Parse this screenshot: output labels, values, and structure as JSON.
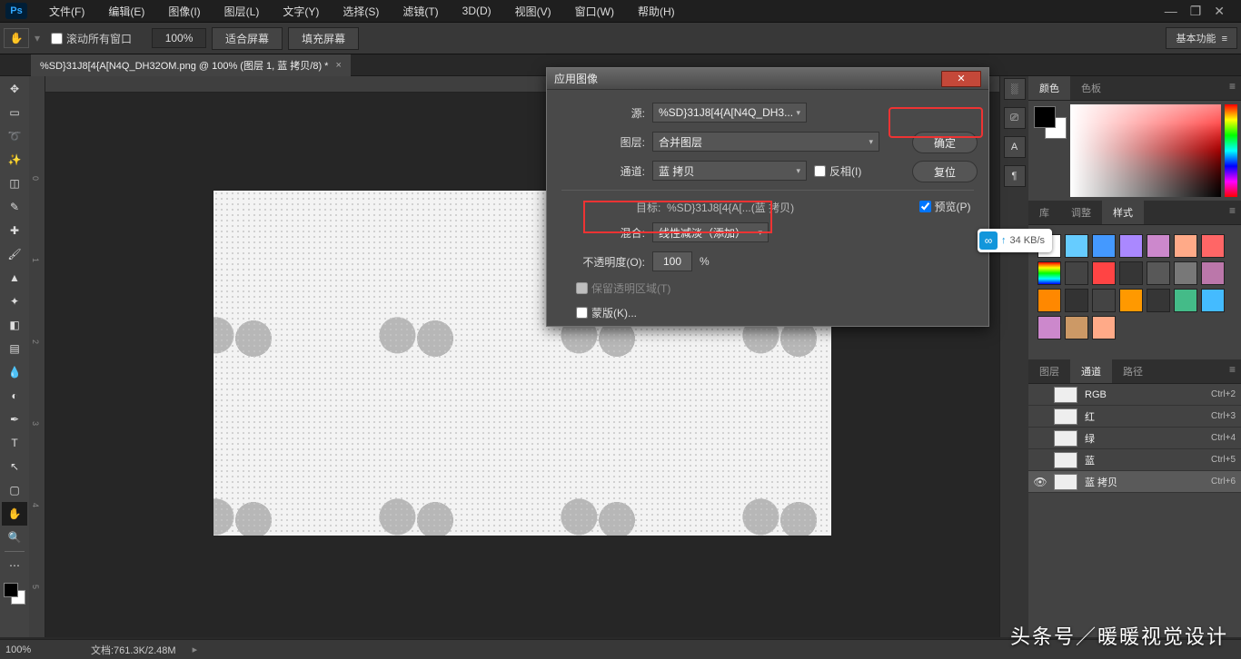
{
  "app": {
    "logo": "Ps"
  },
  "menus": [
    "文件(F)",
    "编辑(E)",
    "图像(I)",
    "图层(L)",
    "文字(Y)",
    "选择(S)",
    "滤镜(T)",
    "3D(D)",
    "视图(V)",
    "窗口(W)",
    "帮助(H)"
  ],
  "window_controls": [
    "—",
    "❐",
    "✕"
  ],
  "options": {
    "scroll_all": "滚动所有窗口",
    "zoom_pct": "100%",
    "fit_screen": "适合屏幕",
    "fill_screen": "填充屏幕",
    "workspace": "基本功能"
  },
  "doc_tab": {
    "title": "%SD}31J8[4{A[N4Q_DH32OM.png @ 100% (图层 1, 蓝 拷贝/8) *"
  },
  "tools": [
    "↔",
    "▭",
    "✂",
    "✎",
    "⟂",
    "◌",
    "✐",
    "▲",
    "✦",
    "◧",
    "◆",
    "✎",
    "✢",
    "T",
    "↖",
    "⟲",
    "✋",
    "⤢"
  ],
  "rulers_v": [
    "0",
    "1",
    "2",
    "3",
    "4",
    "5"
  ],
  "dialog": {
    "title": "应用图像",
    "source_label": "源:",
    "source_value": "%SD}31J8[4{A[N4Q_DH3...",
    "layer_label": "图层:",
    "layer_value": "合并图层",
    "channel_label": "通道:",
    "channel_value": "蓝 拷贝",
    "invert": "反相(I)",
    "target_label": "目标:",
    "target_value": "%SD}31J8[4{A[...(蓝 拷贝)",
    "blend_label": "混合:",
    "blend_value": "线性减淡（添加）",
    "opacity_label": "不透明度(O):",
    "opacity_value": "100",
    "opacity_pct": "%",
    "preserve": "保留透明区域(T)",
    "mask": "蒙版(K)...",
    "ok": "确定",
    "reset": "复位",
    "preview": "预览(P)"
  },
  "color_tabs": [
    "颜色",
    "色板"
  ],
  "style_tabs": [
    "库",
    "调整",
    "样式"
  ],
  "layer_tabs": [
    "图层",
    "通道",
    "路径"
  ],
  "channels": [
    {
      "name": "RGB",
      "key": "Ctrl+2",
      "eye": false,
      "sel": false
    },
    {
      "name": "红",
      "key": "Ctrl+3",
      "eye": false,
      "sel": false
    },
    {
      "name": "绿",
      "key": "Ctrl+4",
      "eye": false,
      "sel": false
    },
    {
      "name": "蓝",
      "key": "Ctrl+5",
      "eye": false,
      "sel": false
    },
    {
      "name": "蓝 拷贝",
      "key": "Ctrl+6",
      "eye": true,
      "sel": true
    }
  ],
  "swatch_colors": [
    "#fff",
    "#6cf",
    "#49f",
    "#a8f",
    "#c8c",
    "#fa8",
    "#f66",
    "linear-gradient(#f00,#ff0,#0f0,#0ff,#00f)",
    "#444",
    "#f44",
    "#363636",
    "#585858",
    "#787878",
    "#b7a",
    "#f80",
    "#333",
    "#444",
    "#f90",
    "#363636",
    "#4b8",
    "#4bf",
    "#c8c",
    "#c96",
    "#fa8"
  ],
  "upload": {
    "speed": "34 KB/s"
  },
  "status": {
    "zoom": "100%",
    "doc": "文档:761.3K/2.48M"
  },
  "right_icons": [
    "░",
    "⎚",
    "◨",
    "A",
    "✎"
  ],
  "watermark": "头条号／暖暖视觉设计"
}
